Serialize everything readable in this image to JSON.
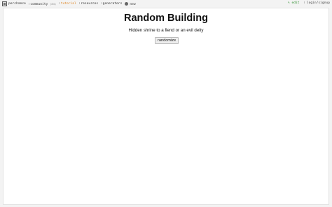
{
  "nav": {
    "site": "perchance",
    "community": "community",
    "community_count": "(84)",
    "tutorial": "tutorial",
    "resources": "resources",
    "generators": "generators",
    "new": "new",
    "edit": "edit",
    "login": "login/signup"
  },
  "page": {
    "title": "Random Building",
    "result": "Hidden shrine to a fiend or an evil deity",
    "button": "randomize"
  }
}
